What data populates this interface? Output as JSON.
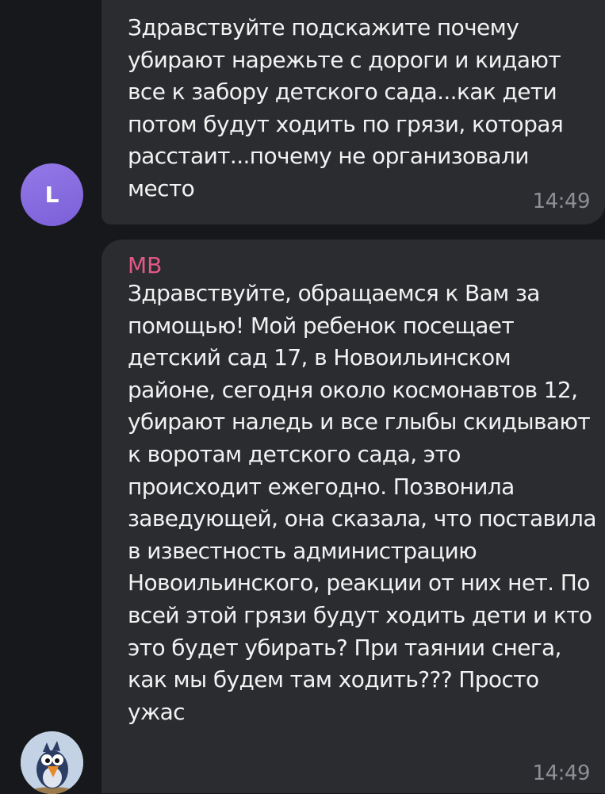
{
  "messages": [
    {
      "avatar_letter": "L",
      "text": "Здравствуйте  подскажите почему убирают нарежьте с дороги и кидают все к забору детского сада...как дети потом будут ходить по грязи, которая расстаит...почему не организовали место",
      "time": "14:49"
    },
    {
      "sender": "MB",
      "text": "Здравствуйте, обращаемся к Вам за помощью! Мой ребенок посещает детский сад 17, в Новоильинском районе, сегодня около космонавтов 12, убирают наледь и все глыбы скидывают к воротам детского сада, это происходит ежегодно. Позвонила заведующей, она сказала, что поставила в известность администрацию Новоильинского, реакции от них нет. По всей этой грязи будут ходить дети и кто это будет убирать? При таянии снега, как мы будем там ходить??? Просто ужас",
      "time": "14:49",
      "avatar": "bird-avatar"
    }
  ],
  "colors": {
    "background": "#17181b",
    "bubble": "#2b2c30",
    "text": "#f2f2f2",
    "sender_name": "#e35886",
    "time": "#8d8f96",
    "avatar_l": "#8a6fe0"
  }
}
